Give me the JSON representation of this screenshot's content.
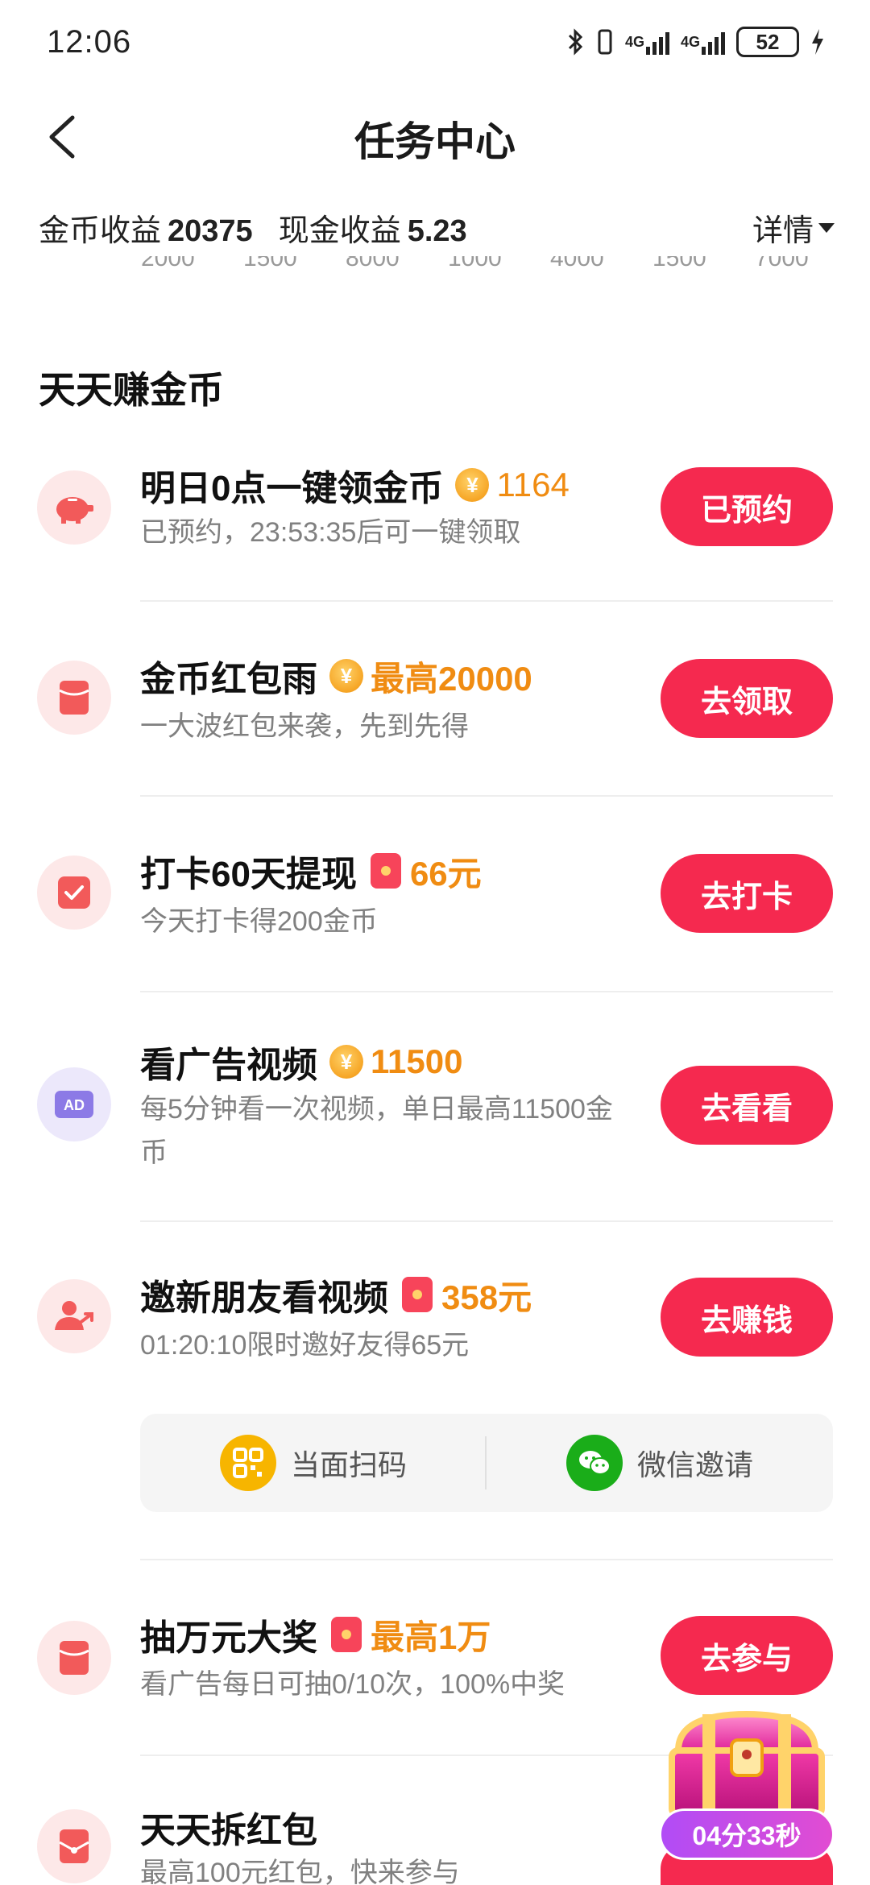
{
  "status_bar": {
    "time": "12:06",
    "net1": "4G",
    "net2": "4G",
    "battery": "52"
  },
  "header": {
    "title": "任务中心"
  },
  "earnings": {
    "coin_label": "金币收益",
    "coin_value": "20375",
    "cash_label": "现金收益",
    "cash_value": "5.23",
    "details_label": "详情"
  },
  "chart_ticks": [
    "2000",
    "1500",
    "8000",
    "1000",
    "4000",
    "1500",
    "7000"
  ],
  "section": {
    "title": "天天赚金币"
  },
  "tasks": [
    {
      "title": "明日0点一键领金币",
      "reward_type": "coin",
      "reward": "1164",
      "desc": "已预约，23:53:35后可一键领取",
      "button": "已预约",
      "icon": "piggy-bank-icon"
    },
    {
      "title": "金币红包雨",
      "reward_type": "coin",
      "reward": "最高20000",
      "desc": "一大波红包来袭，先到先得",
      "button": "去领取",
      "icon": "red-envelope-icon"
    },
    {
      "title": "打卡60天提现",
      "reward_type": "redpack",
      "reward": "66元",
      "desc": "今天打卡得200金币",
      "button": "去打卡",
      "icon": "checkin-icon"
    },
    {
      "title": "看广告视频",
      "reward_type": "coin",
      "reward": "11500",
      "desc": "每5分钟看一次视频，单日最高11500金币",
      "button": "去看看",
      "icon": "ad-icon",
      "icon_text": "AD"
    },
    {
      "title": "邀新朋友看视频",
      "reward_type": "redpack",
      "reward": "358元",
      "desc": "01:20:10限时邀好友得65元",
      "button": "去赚钱",
      "icon": "invite-friends-icon"
    },
    {
      "title": "抽万元大奖",
      "reward_type": "redpack",
      "reward": "最高1万",
      "desc": "看广告每日可抽0/10次，100%中奖",
      "button": "去参与",
      "icon": "red-envelope-icon"
    },
    {
      "title": "天天拆红包",
      "reward_type": "none",
      "reward": "",
      "desc": "最高100元红包，快来参与",
      "button": "",
      "icon": "red-envelope-open-icon"
    }
  ],
  "invite": {
    "scan_label": "当面扫码",
    "wechat_label": "微信邀请"
  },
  "floating": {
    "timer": "04分33秒"
  },
  "colors": {
    "accent": "#f5294f",
    "reward": "#f08c12",
    "icon_bg": "#fde8e8"
  }
}
